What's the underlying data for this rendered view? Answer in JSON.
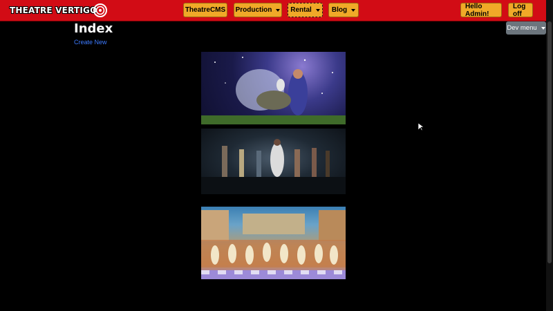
{
  "nav": {
    "brand": "THEATRE VERTIGO",
    "items": [
      {
        "label": "TheatreCMS",
        "dropdown": false
      },
      {
        "label": "Production",
        "dropdown": true
      },
      {
        "label": "Rental",
        "dropdown": true
      },
      {
        "label": "Blog",
        "dropdown": true
      }
    ],
    "greeting": "Hello Admin!",
    "logoff": "Log off"
  },
  "dev_menu": {
    "label": "Dev menu"
  },
  "page": {
    "title": "Index",
    "create_link": "Create New"
  },
  "photos": [
    {
      "description_icon": "photo-icon"
    },
    {
      "description_icon": "photo-icon"
    },
    {
      "description_icon": "photo-icon"
    }
  ],
  "colors": {
    "navbar": "#d20c15",
    "nav_button": "#f0a928",
    "link": "#3d7bff",
    "dev_menu": "#6c757d",
    "background": "#000000"
  }
}
